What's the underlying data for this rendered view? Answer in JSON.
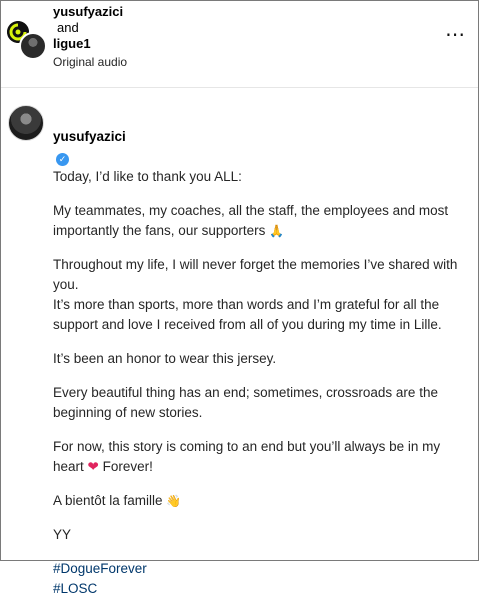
{
  "header": {
    "user1": "yusufyazici",
    "and": "and",
    "user2": "ligue1",
    "audio": "Original audio",
    "more_icon": "⋯"
  },
  "caption": {
    "username": "yusufyazici",
    "verified_icon": "✓",
    "intro": "Today, I’d like to thank you ALL:",
    "paragraphs": [
      "My teammates, my coaches, all the staff, the employees and most importantly the fans, our supporters",
      "Throughout my life, I will never forget the memories I’ve shared with you.\nIt’s more than sports, more than words and I’m grateful for all the support and love I received from all of you during my time in Lille.",
      "It’s been an honor to wear this jersey.",
      "Every beautiful thing has an end; sometimes, crossroads are the beginning of new stories.",
      "For now, this story is coming to an end but you’ll always be in my heart",
      "Forever!",
      "A bientôt la famille",
      "YY"
    ],
    "emoji_pray": "🙏",
    "emoji_heart": "❤",
    "emoji_wave": "👋",
    "hashtags": [
      "#DogueForever",
      "#LOSC"
    ]
  },
  "colors": {
    "hashtag": "#00376b",
    "verified": "#3897f0",
    "heart": "#e0245e"
  }
}
